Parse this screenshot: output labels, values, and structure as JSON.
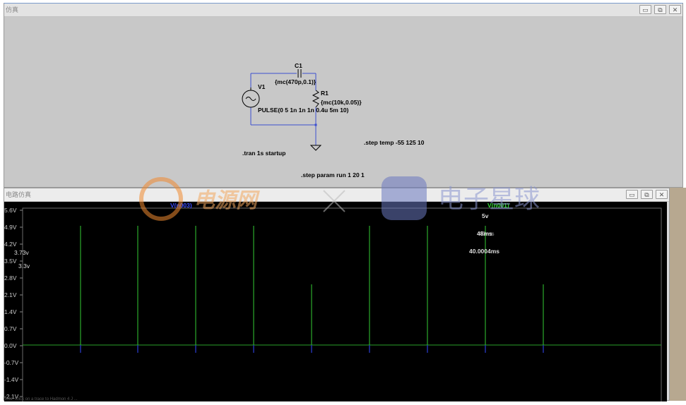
{
  "schematic_window": {
    "title": "仿真",
    "minimize": "▭",
    "restore": "⧉",
    "close": "✕"
  },
  "schematic": {
    "c1_name": "C1",
    "c1_value": "{mc(470p,0.1)}",
    "v1_name": "V1",
    "v1_value": "PULSE(0 5 1n 1n 1n 0.4u 5m 10)",
    "r1_name": "R1",
    "r1_value": "{mc(10k,0.05)}",
    "tran_directive": ".tran 1s startup",
    "step_temp": ".step temp -55 125 10",
    "step_param": ".step param run 1 20 1"
  },
  "waveform_window": {
    "title": "电路仿真",
    "minimize": "▭",
    "restore": "⧉",
    "close": "✕"
  },
  "plot": {
    "trace_left": "V(n003)",
    "trace_right": "V(n001)",
    "cursor_v": "5v",
    "cursor_time": "48ms",
    "cursor_time_overlap": "40ms",
    "cursor_time2": "40.0004ms",
    "marker_a": "3.73v",
    "marker_b": "3.3v",
    "yticks": [
      "5.6V",
      "4.9V",
      "4.2V",
      "3.5V",
      "2.8V",
      "2.1V",
      "1.4V",
      "0.7V",
      "0.0V",
      "-0.7V",
      "-1.4V",
      "-2.1V"
    ]
  },
  "watermarks": {
    "left_text": "电源网",
    "right_text": "电子星球"
  },
  "status_text": "Note: Click on a trace to Hadmon 4 J ... "
}
